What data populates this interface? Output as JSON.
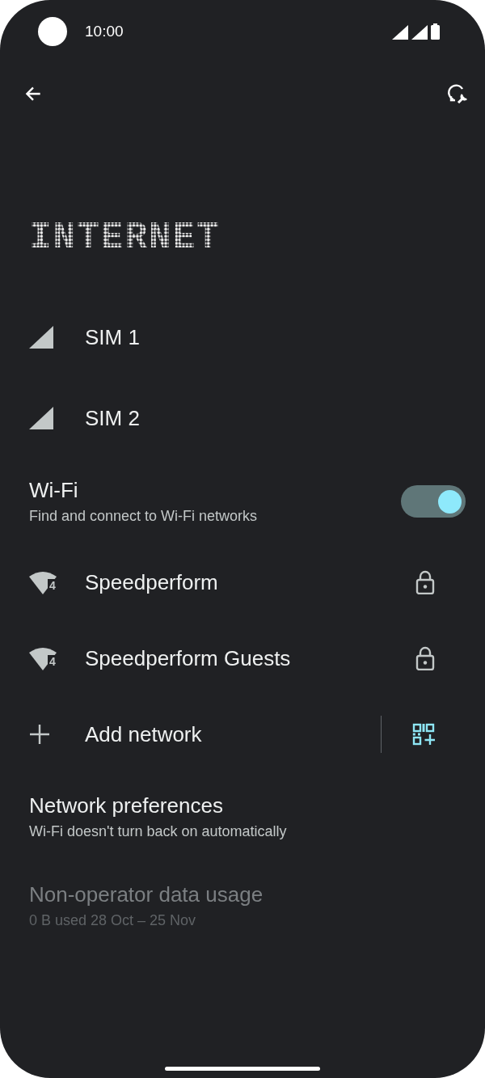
{
  "status_bar": {
    "time": "10:00"
  },
  "title": "INTERNET",
  "sims": [
    {
      "label": "SIM 1"
    },
    {
      "label": "SIM 2"
    }
  ],
  "wifi": {
    "title": "Wi-Fi",
    "summary": "Find and connect to Wi-Fi networks",
    "on": true
  },
  "networks": [
    {
      "name": "Speedperform",
      "generation": "4",
      "secured": true
    },
    {
      "name": "Speedperform Guests",
      "generation": "4",
      "secured": true
    }
  ],
  "add_network": {
    "label": "Add network"
  },
  "preferences": [
    {
      "title": "Network preferences",
      "summary": "Wi-Fi doesn't turn back on automatically",
      "disabled": false
    },
    {
      "title": "Non-operator data usage",
      "summary": "0 B used 28 Oct – 25 Nov",
      "disabled": true
    }
  ]
}
